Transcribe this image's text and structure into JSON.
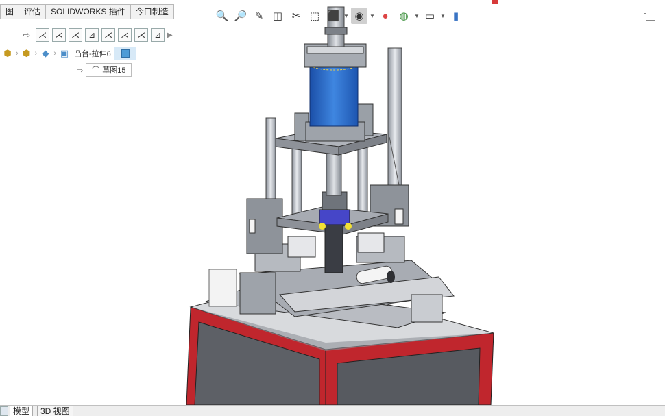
{
  "command_tabs": [
    "图",
    "评估",
    "SOLIDWORKS 插件",
    "今口制造"
  ],
  "sketch_toolbar": {
    "icons": [
      "sketch-arrow-icon",
      "line-icon",
      "line-icon",
      "line-icon",
      "smart-dimension-icon",
      "line-icon",
      "line-icon",
      "line-icon",
      "smart-dimension-icon",
      "expand-arrow-icon"
    ]
  },
  "breadcrumb": {
    "feature_label": "凸台-拉伸6",
    "sketch_label": "草图15"
  },
  "hud_icons": [
    "zoom-to-fit-icon",
    "zoom-area-icon",
    "previous-view-icon",
    "section-view-icon",
    "dynamic-annotation-icon",
    "view-orientation-icon",
    "display-style-icon",
    "hide-show-items-icon",
    "edit-appearance-icon",
    "apply-scene-icon",
    "view-settings-icon",
    "split-view-icon"
  ],
  "bottom_tabs": {
    "model": "模型",
    "view3d": "3D 视图"
  },
  "colors": {
    "frame_red": "#c0262d",
    "cylinder_blue": "#2f6fc8",
    "metal_gray": "#b9bcc2",
    "panel_dark": "#5d6066"
  }
}
